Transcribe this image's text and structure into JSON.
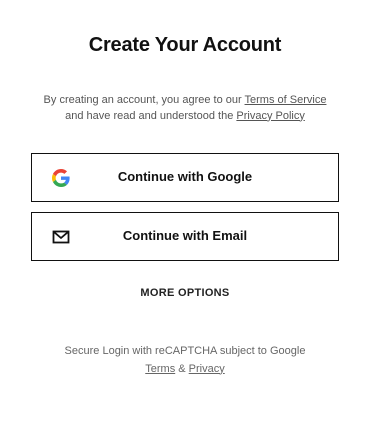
{
  "header": {
    "title": "Create Your Account"
  },
  "agreement": {
    "line1_prefix": "By creating an account, you agree to our",
    "terms_link": "Terms of Service",
    "line2_prefix": "and have read and understood the",
    "privacy_link": "Privacy Policy"
  },
  "buttons": {
    "google": {
      "label": "Continue with Google",
      "icon": "google-logo-icon"
    },
    "email": {
      "label": "Continue with Email",
      "icon": "envelope-icon"
    }
  },
  "more_options": {
    "label": "MORE OPTIONS"
  },
  "recaptcha": {
    "text": "Secure Login with reCAPTCHA subject to Google",
    "terms_link": "Terms",
    "separator": "&",
    "privacy_link": "Privacy"
  },
  "colors": {
    "text": "#111111",
    "muted": "#555555",
    "border": "#111111",
    "google_blue": "#4285F4",
    "google_red": "#EA4335",
    "google_yellow": "#FBBC05",
    "google_green": "#34A853"
  }
}
